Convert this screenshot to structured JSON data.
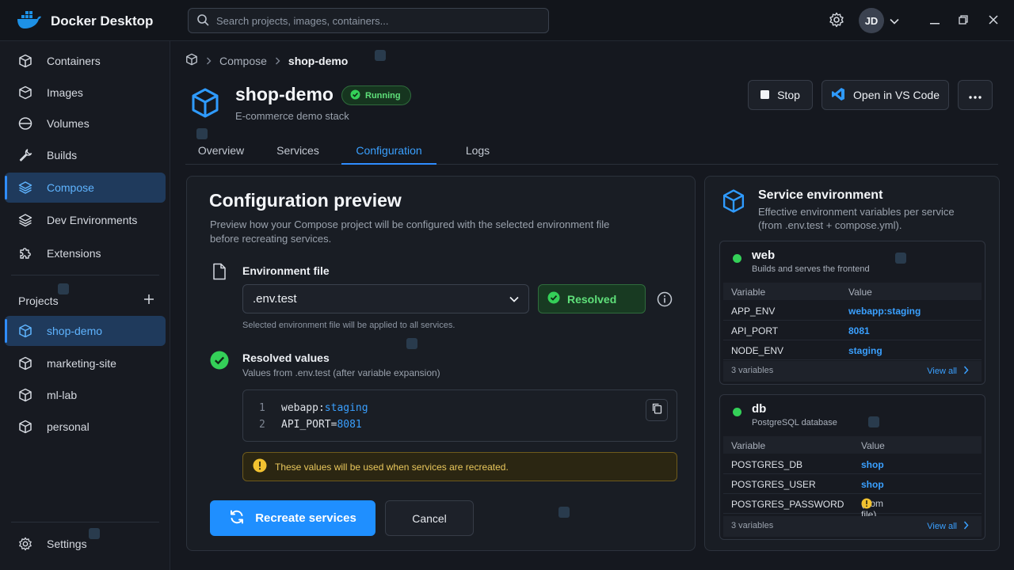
{
  "app": {
    "title": "Docker Desktop",
    "user_initials": "JD"
  },
  "search": {
    "placeholder": "Search projects, images, containers..."
  },
  "sidebar": {
    "items": [
      {
        "label": "Containers",
        "icon": "cube-icon"
      },
      {
        "label": "Images",
        "icon": "image-layers-icon"
      },
      {
        "label": "Volumes",
        "icon": "volume-icon"
      },
      {
        "label": "Builds",
        "icon": "wrench-icon"
      },
      {
        "label": "Compose",
        "icon": "layers-icon",
        "active": true
      },
      {
        "label": "Dev Environments",
        "icon": "stack-icon"
      },
      {
        "label": "Extensions",
        "icon": "puzzle-icon"
      }
    ],
    "projects_label": "Projects",
    "projects": [
      "shop-demo",
      "marketing-site",
      "ml-lab",
      "personal"
    ],
    "settings_label": "Settings"
  },
  "breadcrumb": {
    "parent": "Compose",
    "current": "shop-demo"
  },
  "project": {
    "name": "shop-demo",
    "status": "Running",
    "description": "E-commerce demo stack"
  },
  "actions": {
    "stop": "Stop",
    "open_vscode": "Open in VS Code"
  },
  "tabs": [
    "Overview",
    "Services",
    "Configuration",
    "Logs"
  ],
  "config": {
    "title": "Configuration preview",
    "description": "Preview how your Compose project will be configured with the selected environment file before recreating services.",
    "env_label": "Environment file",
    "env_value": ".env.test",
    "env_status": "Resolved",
    "env_hint": "Selected environment file will be applied to all services.",
    "resolved_title": "Resolved values",
    "resolved_sub": "Values from .env.test (after variable expansion)",
    "lines": [
      {
        "num": "1",
        "key": "webapp:",
        "value": "staging"
      },
      {
        "num": "2",
        "key": "API_PORT=",
        "value": "8081"
      }
    ],
    "warning": "These values will be used when services are recreated.",
    "recreate": "Recreate services",
    "cancel": "Cancel"
  },
  "service_env": {
    "title": "Service environment",
    "subtitle": "Effective environment variables per service (from .env.test + compose.yml).",
    "col_variable": "Variable",
    "col_value": "Value",
    "view_all": "View all",
    "services": [
      {
        "name": "web",
        "description": "Builds and serves the frontend",
        "vars": [
          {
            "name": "APP_ENV",
            "value": "webapp:staging"
          },
          {
            "name": "API_PORT",
            "value": "8081"
          },
          {
            "name": "NODE_ENV",
            "value": "staging"
          }
        ],
        "count": "3 variables"
      },
      {
        "name": "db",
        "description": "PostgreSQL database",
        "vars": [
          {
            "name": "POSTGRES_DB",
            "value": "shop"
          },
          {
            "name": "POSTGRES_USER",
            "value": "shop"
          },
          {
            "name": "POSTGRES_PASSWORD",
            "value": "(from file)"
          }
        ],
        "count": "3 variables"
      }
    ]
  },
  "colors": {
    "accent": "#1f8fff",
    "success": "#34d058",
    "warning": "#e9c75c",
    "sidebar_active": "#1f3a5c"
  }
}
